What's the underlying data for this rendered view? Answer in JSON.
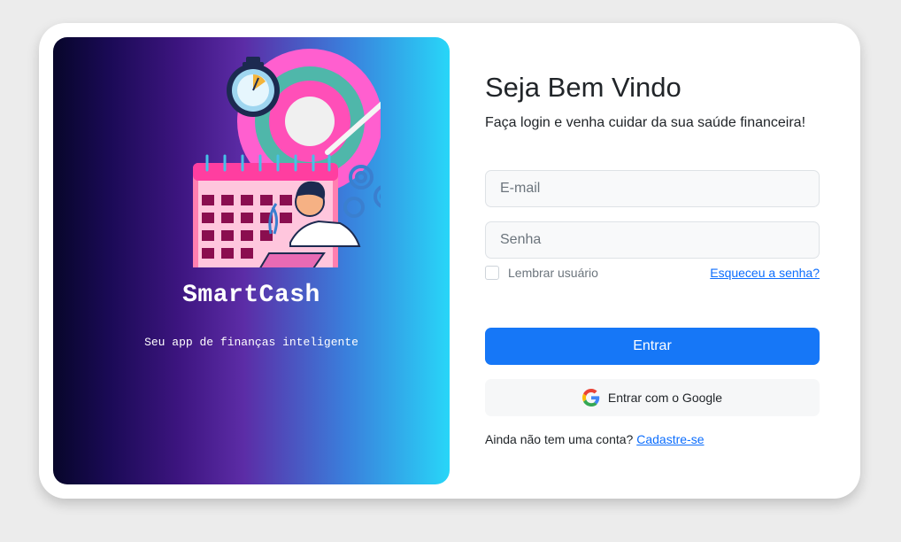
{
  "hero": {
    "app_name": "SmartCash",
    "tagline": "Seu app de finanças inteligente"
  },
  "login": {
    "title": "Seja Bem Vindo",
    "subtitle": "Faça login e venha cuidar da sua saúde financeira!",
    "email_placeholder": "E-mail",
    "password_placeholder": "Senha",
    "remember_label": "Lembrar usuário",
    "forgot_label": "Esqueceu a senha?",
    "submit_label": "Entrar",
    "google_label": "Entrar com o Google",
    "signup_prompt": "Ainda não tem uma conta?",
    "signup_link": "Cadastre-se"
  },
  "colors": {
    "primary": "#1677f7",
    "link": "#0d6efd",
    "gradient_start": "#07062a",
    "gradient_mid": "#5c2ca6",
    "gradient_end": "#28d6f8"
  },
  "icons": [
    "stopwatch-icon",
    "target-icon",
    "calendar-icon",
    "gear-icon",
    "google-icon"
  ]
}
